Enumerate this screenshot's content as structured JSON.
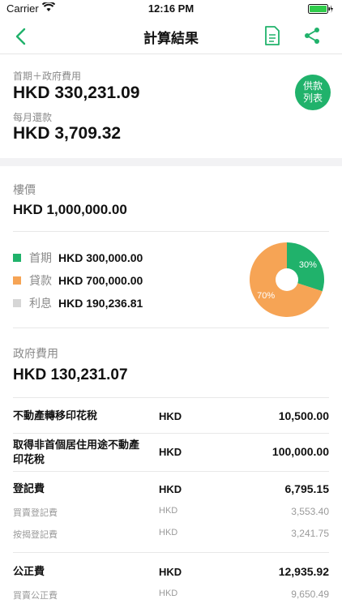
{
  "status_bar": {
    "carrier": "Carrier",
    "time": "12:16 PM"
  },
  "nav": {
    "title": "計算結果"
  },
  "summary": {
    "first_label": "首期＋政府費用",
    "first_value": "HKD 330,231.09",
    "monthly_label": "每月還款",
    "monthly_value": "HKD 3,709.32",
    "schedule_button": "供款列表"
  },
  "property": {
    "label": "樓價",
    "value": "HKD 1,000,000.00"
  },
  "breakdown": {
    "items": [
      {
        "name": "首期",
        "value": "HKD 300,000.00",
        "color": "#20b26b"
      },
      {
        "name": "貸款",
        "value": "HKD 700,000.00",
        "color": "#f6a455"
      },
      {
        "name": "利息",
        "value": "HKD 190,236.81",
        "color": "#d6d6d6"
      }
    ]
  },
  "chart_data": {
    "type": "pie",
    "slices": [
      {
        "label": "30%",
        "value": 30,
        "color": "#20b26b"
      },
      {
        "label": "70%",
        "value": 70,
        "color": "#f6a455"
      }
    ]
  },
  "gov_fees": {
    "label": "政府費用",
    "total": "HKD 130,231.07",
    "rows": [
      {
        "name": "不動產轉移印花稅",
        "currency": "HKD",
        "amount": "10,500.00"
      },
      {
        "name": "取得非首個居住用途不動產印花稅",
        "currency": "HKD",
        "amount": "100,000.00"
      },
      {
        "name": "登記費",
        "currency": "HKD",
        "amount": "6,795.15"
      },
      {
        "name": "買賣登記費",
        "currency": "HKD",
        "amount": "3,553.40"
      },
      {
        "name": "按揭登記費",
        "currency": "HKD",
        "amount": "3,241.75"
      },
      {
        "name": "公正費",
        "currency": "HKD",
        "amount": "12,935.92"
      },
      {
        "name": "買賣公正費",
        "currency": "HKD",
        "amount": "9,650.49"
      }
    ]
  },
  "colors": {
    "accent": "#20b26b",
    "loan": "#f6a455",
    "interest": "#d6d6d6"
  }
}
